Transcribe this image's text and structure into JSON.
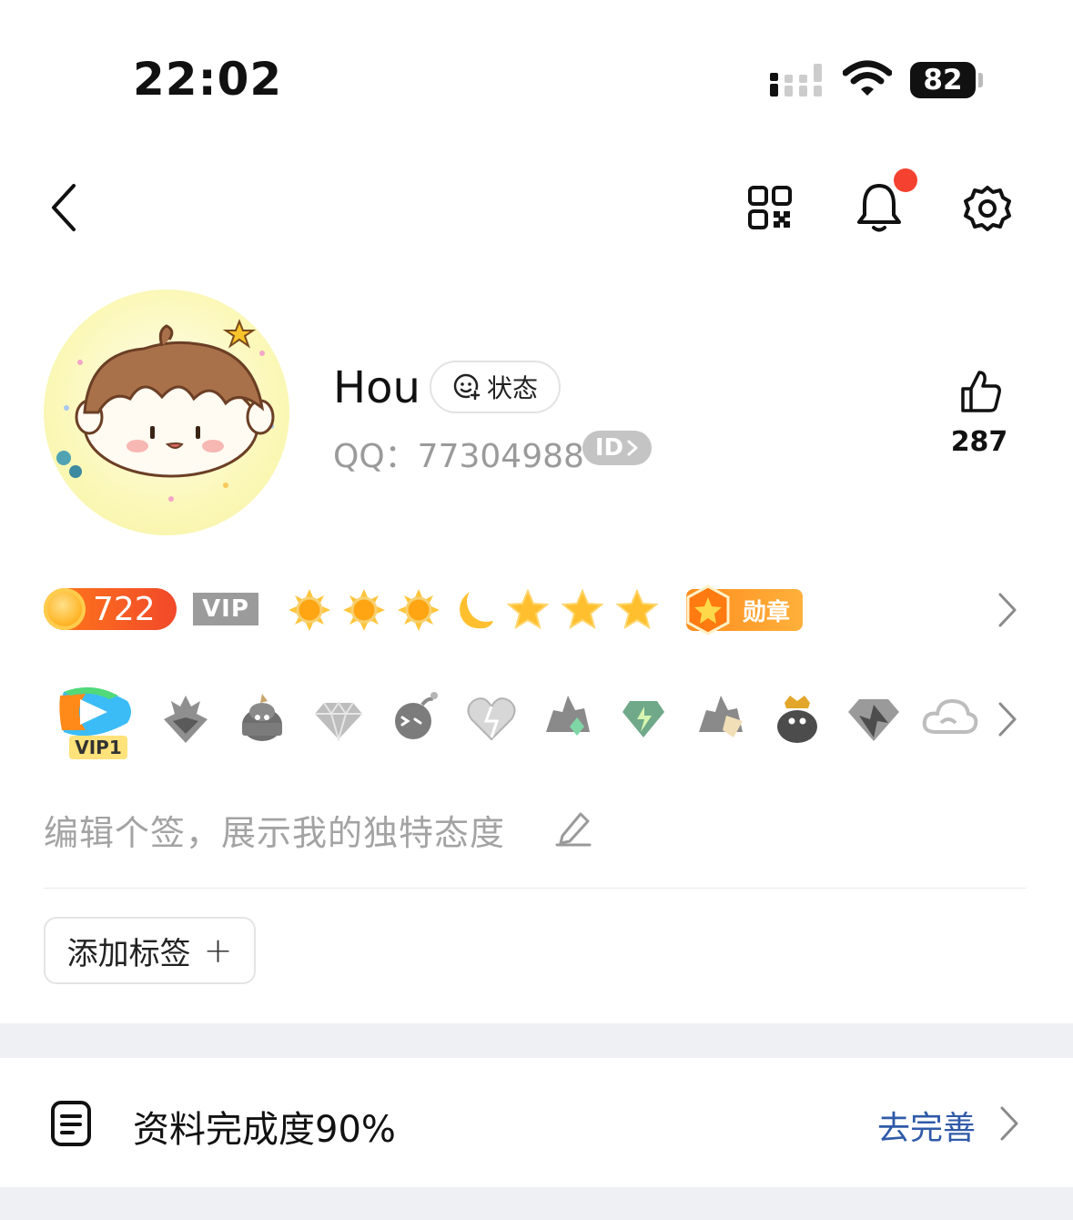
{
  "status_bar": {
    "time": "22:02",
    "battery": "82",
    "icons": [
      "cellular-signal-icon",
      "wifi-icon",
      "battery-icon"
    ]
  },
  "nav": {
    "icons": [
      "back-chevron-icon",
      "qr-code-icon",
      "bell-icon",
      "gear-icon"
    ],
    "notification_dot_color": "#f5412f"
  },
  "profile": {
    "nickname": "Hou",
    "status_label": "状态",
    "qq_label": "QQ：77304988",
    "id_badge": "ID",
    "like_count": "287"
  },
  "level_row": {
    "coin_value": "722",
    "vip_label": "VIP",
    "level_icons": [
      "sun-icon",
      "sun-icon",
      "sun-icon",
      "moon-icon",
      "star-icon",
      "star-icon",
      "star-icon"
    ],
    "medal_label": "勋章"
  },
  "badges": {
    "vip_badge_label": "VIP1",
    "icons": [
      "video-vip-icon",
      "gray-wing-badge-icon",
      "penguin-hat-badge-icon",
      "diamond-badge-icon",
      "bomb-badge-icon",
      "heart-badge-icon",
      "rock-badge-icon",
      "green-gem-badge-icon",
      "paper-rock-badge-icon",
      "penguin-crown-badge-icon",
      "gray-diamond-badge-icon",
      "cloud-badge-icon"
    ]
  },
  "signature": {
    "placeholder": "编辑个签，展示我的独特态度"
  },
  "tags": {
    "add_label": "添加标签",
    "plus": "+"
  },
  "profile_completion": {
    "label": "资料完成度90%",
    "action": "去完善"
  },
  "colors": {
    "accent_link": "#2f5aa8",
    "coin_orange": "#f1492a",
    "medal_orange": "#ff8d1f"
  }
}
